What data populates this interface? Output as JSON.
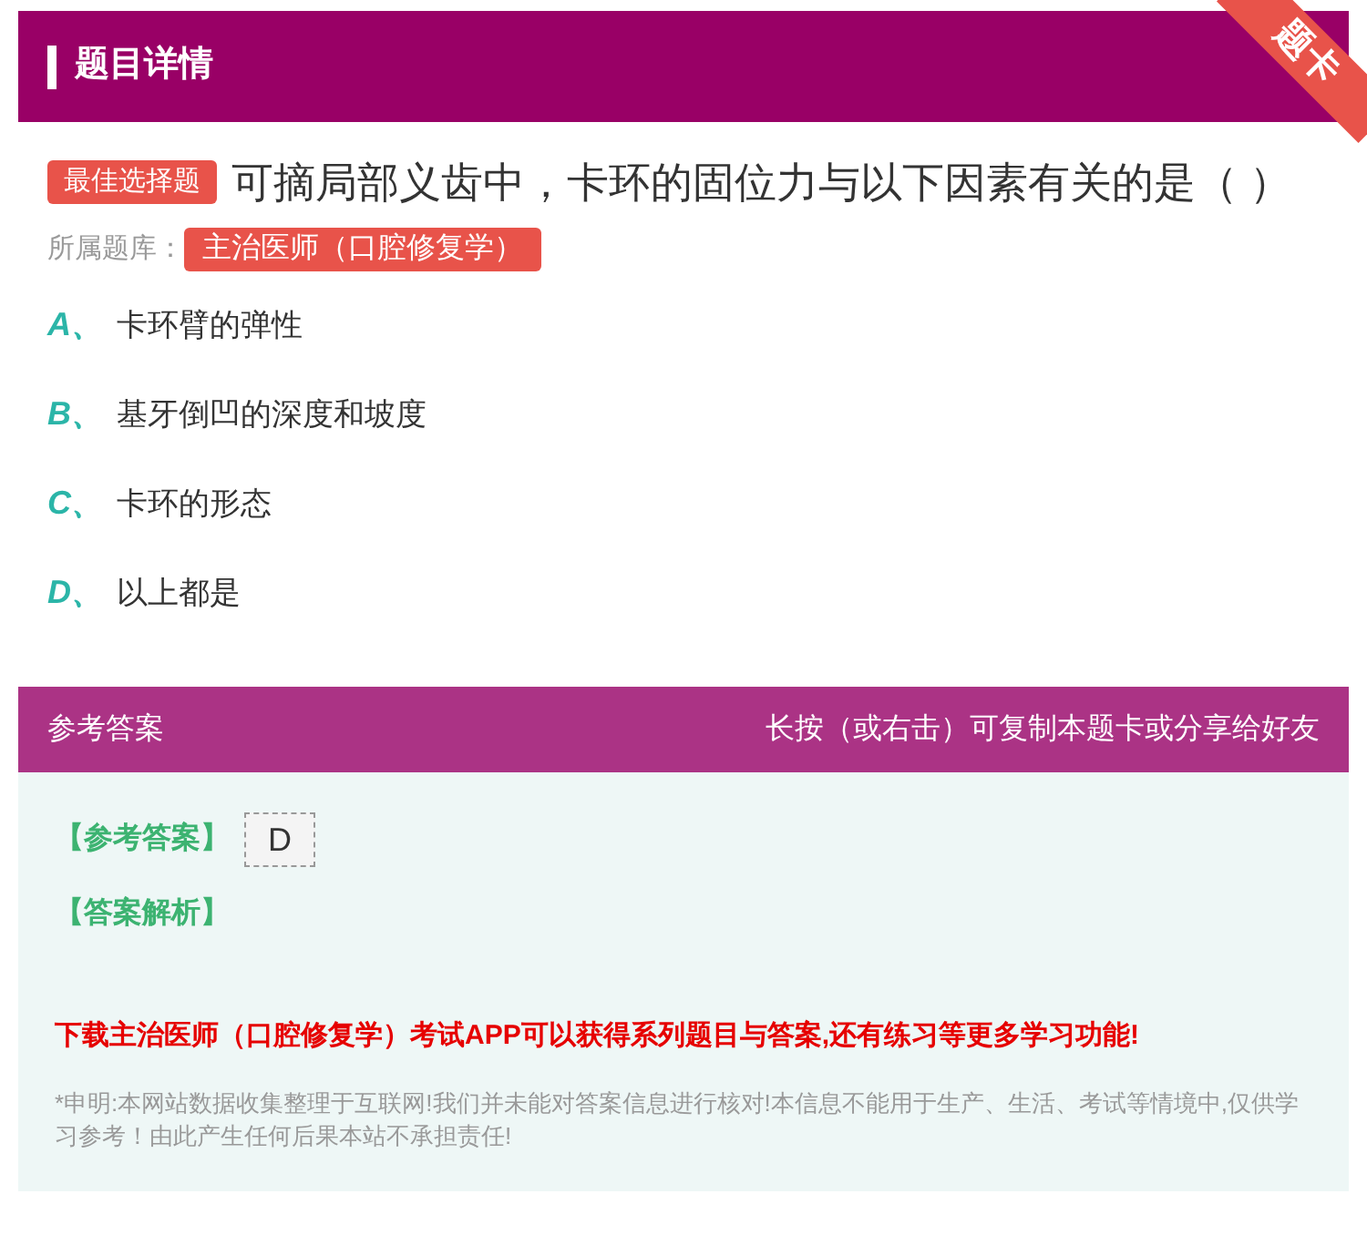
{
  "header": {
    "title": "题目详情",
    "ribbon": "题卡"
  },
  "question": {
    "type_badge": "最佳选择题",
    "text": "可摘局部义齿中，卡环的固位力与以下因素有关的是（ ）",
    "bank_label": "所属题库：",
    "bank": "主治医师（口腔修复学）"
  },
  "options": [
    {
      "letter": "A、",
      "text": "卡环臂的弹性"
    },
    {
      "letter": "B、",
      "text": "基牙倒凹的深度和坡度"
    },
    {
      "letter": "C、",
      "text": "卡环的形态"
    },
    {
      "letter": "D、",
      "text": "以上都是"
    }
  ],
  "answer_section": {
    "title": "参考答案",
    "hint": "长按（或右击）可复制本题卡或分享给好友",
    "answer_label": "【参考答案】",
    "answer": "D",
    "analysis_label": "【答案解析】",
    "promo": "下载主治医师（口腔修复学）考试APP可以获得系列题目与答案,还有练习等更多学习功能!",
    "disclaimer": "*申明:本网站数据收集整理于互联网!我们并未能对答案信息进行核对!本信息不能用于生产、生活、考试等情境中,仅供学习参考！由此产生任何后果本站不承担责任!"
  }
}
